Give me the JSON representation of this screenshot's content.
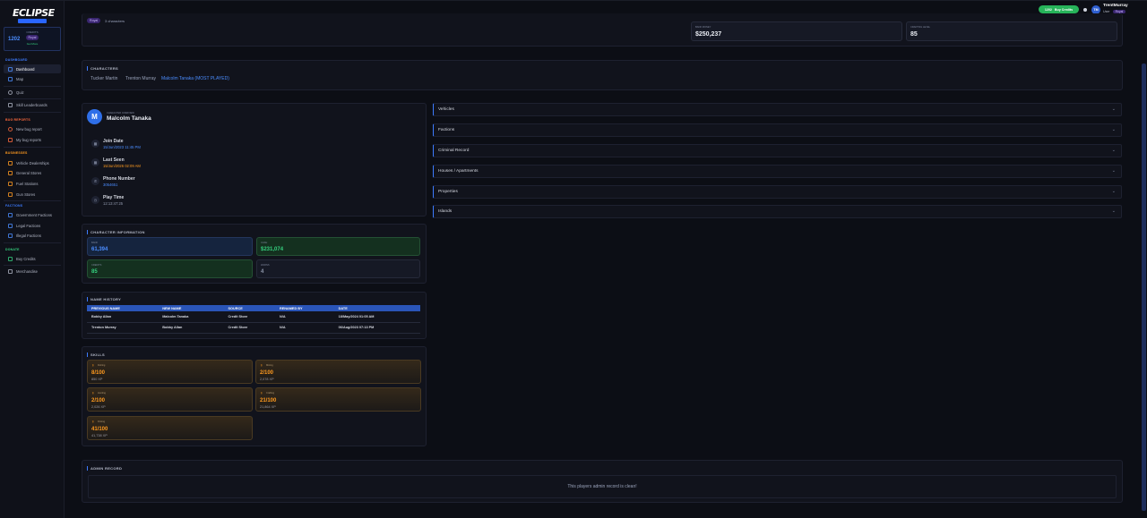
{
  "brand": {
    "logo_text": "ECLIPSE"
  },
  "sidebar": {
    "credits": {
      "label": "CREDITS",
      "value": "1202",
      "badge": "Royal",
      "status": "Get More"
    },
    "sections": [
      {
        "title": "DASHBOARD",
        "color": "#3d7bff"
      },
      {
        "title": "BUG REPORTS",
        "color": "#ff6a3d"
      },
      {
        "title": "BUSINESSES",
        "color": "#ff9a1f"
      },
      {
        "title": "FACTIONS",
        "color": "#3d7bff"
      },
      {
        "title": "DONATE",
        "color": "#35d07f"
      }
    ],
    "items": [
      {
        "label": "Dashboard",
        "icon": "grid-icon",
        "color": "#4b8dff"
      },
      {
        "label": "Map",
        "icon": "map-icon",
        "color": "#4b8dff"
      },
      {
        "label": "Quiz",
        "icon": "question-icon",
        "color": "#9aa3bb"
      },
      {
        "label": "Skill Leaderboards",
        "icon": "trophy-icon",
        "color": "#9aa3bb"
      },
      {
        "label": "New bug report",
        "icon": "bug-icon",
        "color": "#ff6a3d"
      },
      {
        "label": "My bug reports",
        "icon": "list-icon",
        "color": "#ff6a3d"
      },
      {
        "label": "Vehicle Dealerships",
        "icon": "car-icon",
        "color": "#ff9a1f"
      },
      {
        "label": "General Stores",
        "icon": "store-icon",
        "color": "#ff9a1f"
      },
      {
        "label": "Fuel Stations",
        "icon": "fuel-icon",
        "color": "#ff9a1f"
      },
      {
        "label": "Gun Stores",
        "icon": "gun-icon",
        "color": "#ff9a1f"
      },
      {
        "label": "Government Factions",
        "icon": "building-icon",
        "color": "#4b8dff"
      },
      {
        "label": "Legal Factions",
        "icon": "scale-icon",
        "color": "#4b8dff"
      },
      {
        "label": "Illegal Factions",
        "icon": "mask-icon",
        "color": "#4b8dff"
      },
      {
        "label": "Buy Credits",
        "icon": "card-icon",
        "color": "#35d07f"
      },
      {
        "label": "Merchandise",
        "icon": "cart-icon",
        "color": "#9aa3bb"
      }
    ]
  },
  "topbar": {
    "buy_credits": "Buy Credits",
    "buy_credits_pill": "1202",
    "avatar_initials": "TM",
    "username": "TrentMurray",
    "role": "User",
    "role_badge": "Royal"
  },
  "header": {
    "badge": "Royal",
    "characters_count": "3 characters",
    "cards": [
      {
        "label": "BANK MONEY",
        "value": "$250,237"
      },
      {
        "label": "CRAFTING LEVEL",
        "value": "85"
      }
    ]
  },
  "characters": {
    "title": "CHARACTERS",
    "tabs": [
      "Tucker Martin",
      "Trenton Murray",
      "Malcolm Tanaka (MOST PLAYED)"
    ]
  },
  "profile": {
    "initial": "M",
    "subtitle": "CHARACTER OVERVIEW",
    "name": "Malcolm Tanaka",
    "rows": [
      {
        "key": "Join Date",
        "value": "15/Jun/2023 11:45 PM",
        "color": "#4b8dff"
      },
      {
        "key": "Last Seen",
        "value": "15/Jun/2026 02:09 AM",
        "color": "#ff9a1f"
      },
      {
        "key": "Phone Number",
        "value": "3054651",
        "color": "#4b8dff"
      },
      {
        "key": "Play Time",
        "value": "12:13:47:25",
        "color": "#8f97ab"
      }
    ]
  },
  "char_info": {
    "title": "CHARACTER INFORMATION",
    "cards": [
      {
        "label": "BANK",
        "value": "61,394",
        "color": "#4b8dff"
      },
      {
        "label": "CASH",
        "value": "$231,074",
        "color": "#35d07f"
      },
      {
        "label": "CREDITS",
        "value": "85",
        "color": "#35d07f"
      },
      {
        "label": "WARNS",
        "value": "4",
        "color": "#8f97ab"
      }
    ]
  },
  "name_history": {
    "title": "NAME HISTORY",
    "headers": [
      "PREVIOUS NAME",
      "NEW NAME",
      "SOURCE",
      "RENAMED BY",
      "DATE"
    ],
    "rows": [
      [
        "Bobby Allan",
        "Malcolm Tanaka",
        "Credit Store",
        "N/A",
        "18/May/2024 01:05 AM"
      ],
      [
        "Trenton Murray",
        "Bobby Allan",
        "Credit Store",
        "N/A",
        "06/Aug/2023 07:13 PM"
      ]
    ]
  },
  "skills": {
    "title": "SKILLS",
    "items": [
      {
        "name": "Fishing",
        "level": "8/100",
        "xp": "850 XP"
      },
      {
        "name": "Mining",
        "level": "2/100",
        "xp": "2,078 XP"
      },
      {
        "name": "Hunting",
        "level": "2/100",
        "xp": "2,026 XP"
      },
      {
        "name": "Crafting",
        "level": "21/100",
        "xp": "21,864 XP"
      },
      {
        "name": "Driving",
        "level": "41/100",
        "xp": "41,738 XP"
      }
    ]
  },
  "accordions": [
    "Vehicles",
    "Factions",
    "Criminal Record",
    "Houses / Apartments",
    "Properties",
    "Islands"
  ],
  "admin": {
    "title": "ADMIN RECORD",
    "message": "This players admin record is clean!"
  }
}
